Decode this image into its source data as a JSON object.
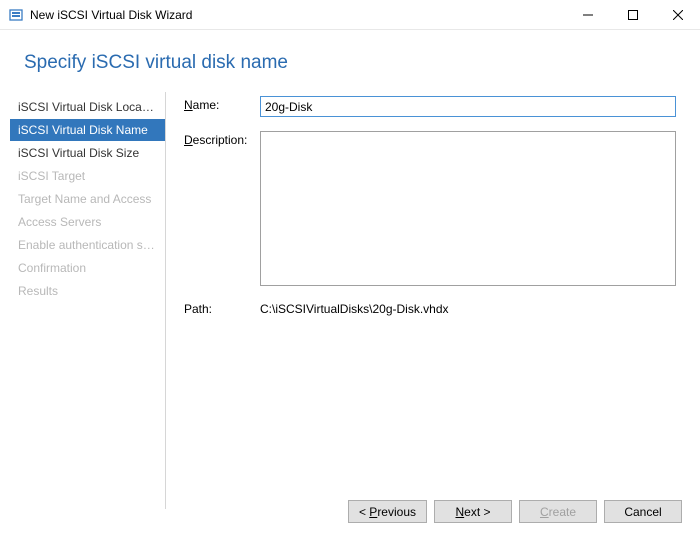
{
  "titlebar": {
    "title": "New iSCSI Virtual Disk Wizard"
  },
  "page": {
    "heading": "Specify iSCSI virtual disk name"
  },
  "sidebar": {
    "items": [
      {
        "label": "iSCSI Virtual Disk Location",
        "state": "normal"
      },
      {
        "label": "iSCSI Virtual Disk Name",
        "state": "active"
      },
      {
        "label": "iSCSI Virtual Disk Size",
        "state": "normal"
      },
      {
        "label": "iSCSI Target",
        "state": "disabled"
      },
      {
        "label": "Target Name and Access",
        "state": "disabled"
      },
      {
        "label": "Access Servers",
        "state": "disabled"
      },
      {
        "label": "Enable authentication ser...",
        "state": "disabled"
      },
      {
        "label": "Confirmation",
        "state": "disabled"
      },
      {
        "label": "Results",
        "state": "disabled"
      }
    ]
  },
  "form": {
    "name_label": "Name:",
    "name_accel": "N",
    "name_value": "20g-Disk",
    "desc_label": "Description:",
    "desc_accel": "D",
    "desc_value": "",
    "path_label": "Path:",
    "path_value": "C:\\iSCSIVirtualDisks\\20g-Disk.vhdx"
  },
  "buttons": {
    "previous": "< Previous",
    "previous_accel": "P",
    "next": "Next >",
    "next_accel": "N",
    "create": "Create",
    "create_accel": "C",
    "cancel": "Cancel"
  }
}
